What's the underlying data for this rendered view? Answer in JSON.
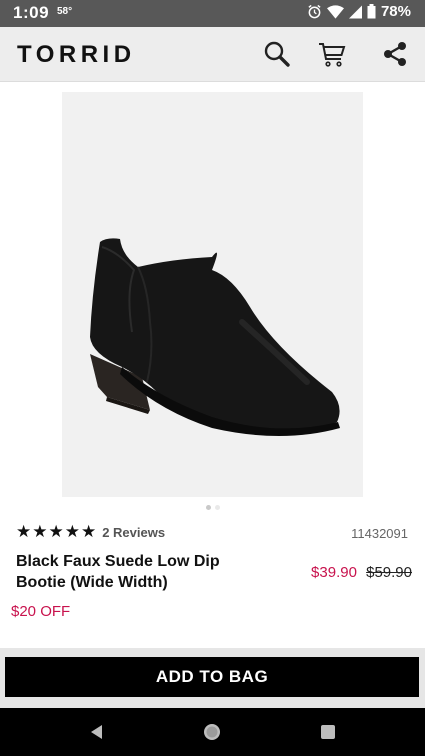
{
  "status_bar": {
    "time": "1:09",
    "temperature": "58°",
    "battery": "78%",
    "icons": [
      "alarm-icon",
      "wifi-icon",
      "signal-icon",
      "battery-icon"
    ]
  },
  "header": {
    "brand": "TORRID",
    "icons": [
      "search-icon",
      "cart-icon",
      "share-icon"
    ]
  },
  "product": {
    "image_description_icon": "bootie-image",
    "carousel": {
      "count": 2,
      "active_index": 1
    },
    "rating": {
      "stars": "★★★★★",
      "value": 5,
      "max": 5,
      "reviews_label": "2 Reviews"
    },
    "sku": "11432091",
    "title": "Black Faux Suede Low Dip Bootie (Wide Width)",
    "sale_price": "$39.90",
    "original_price": "$59.90",
    "discount": "$20 OFF"
  },
  "cta": {
    "add_to_bag": "ADD TO BAG"
  },
  "nav": {
    "icons": [
      "back-icon",
      "home-icon",
      "recents-icon"
    ]
  },
  "colors": {
    "sale": "#c8124d",
    "button": "#000000",
    "header_bg": "#ededed",
    "status_bg": "#585858"
  }
}
